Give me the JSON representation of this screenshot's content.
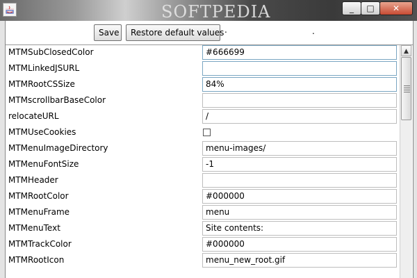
{
  "window": {
    "watermark": "SOFTPEDIA",
    "minimize_glyph": "_",
    "maximize_glyph": "□",
    "close_glyph": "✕",
    "icon": "java-app-icon"
  },
  "toolbar": {
    "save_label": "Save",
    "restore_label": "Restore default values",
    "dot1": ".",
    "dot2": "."
  },
  "properties": [
    {
      "name": "MTMSubClosedColor",
      "type": "text",
      "value": "#666699",
      "focused": true
    },
    {
      "name": "MTMLinkedJSURL",
      "type": "text",
      "value": "",
      "focused": true
    },
    {
      "name": "MTMRootCSSize",
      "type": "text",
      "value": "84%",
      "focused": true
    },
    {
      "name": "MTMscrollbarBaseColor",
      "type": "text",
      "value": ""
    },
    {
      "name": "relocateURL",
      "type": "text",
      "value": "/"
    },
    {
      "name": "MTMUseCookies",
      "type": "checkbox",
      "value": false
    },
    {
      "name": "MTMenuImageDirectory",
      "type": "text",
      "value": "menu-images/"
    },
    {
      "name": "MTMenuFontSize",
      "type": "text",
      "value": "-1"
    },
    {
      "name": "MTMHeader",
      "type": "text",
      "value": ""
    },
    {
      "name": "MTMRootColor",
      "type": "text",
      "value": "#000000"
    },
    {
      "name": "MTMenuFrame",
      "type": "text",
      "value": "menu"
    },
    {
      "name": "MTMenuText",
      "type": "text",
      "value": "Site contents:"
    },
    {
      "name": "MTMTrackColor",
      "type": "text",
      "value": "#000000"
    },
    {
      "name": "MTMRootIcon",
      "type": "text",
      "value": "menu_new_root.gif"
    }
  ],
  "scrollbar": {
    "up_arrow": "▲",
    "position_fraction": 0.0
  },
  "colors": {
    "close_button": "#c74b33",
    "focus_border": "#7aa6c2"
  }
}
